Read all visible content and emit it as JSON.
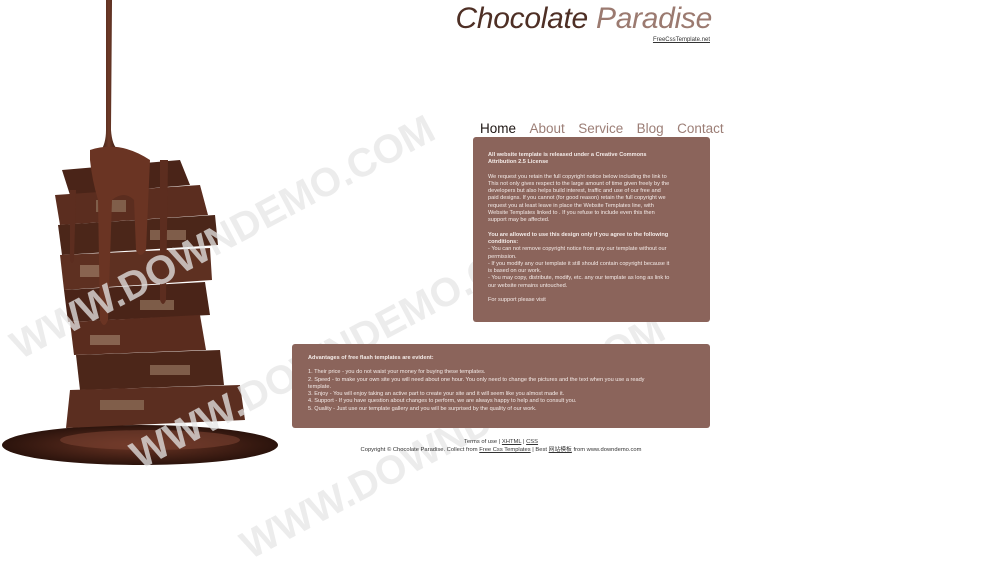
{
  "header": {
    "title_word1": "Chocolate",
    "title_word2": "Paradise",
    "credit_link": "FreeCssTemplate.net"
  },
  "nav": {
    "items": [
      "Home",
      "About",
      "Service",
      "Blog",
      "Contact"
    ],
    "active": "Home"
  },
  "license_box": {
    "heading_line1": "All website template is released under a Creative Commons",
    "heading_line2": "Attribution 2.5 License",
    "paragraph_lines": [
      "We request you retain the full copyright notice below including the link to",
      "This not only gives respect to the large amount of time given freely by the",
      "developers but also helps build interest, traffic and use of our free and",
      "paid designs. If you cannot (for good reason) retain the full copyright we",
      "request you at least leave in place the Website Templates line, with",
      "Website Templates linked to . If you refuse to include even this then",
      "support may be affected."
    ],
    "conditions_heading_line1": "You are allowed to use this design only if you agree to the following",
    "conditions_heading_line2": "conditions:",
    "conditions_lines": [
      "- You can not remove copyright notice from any our template without our",
      "permission.",
      "- If you modify any our template it still should contain copyright because it",
      "is based on our work.",
      "- You may copy, distribute, modify, etc. any our template as long as link to",
      "our website remains untouched."
    ],
    "support_text": "For support please visit"
  },
  "advantages_box": {
    "heading": "Advantages of free flash templates are evident:",
    "lines": [
      "1. Their price - you do not waist your money for buying these templates.",
      "2. Speed - to make your own site you will need about one hour. You only need to change the pictures and the text when you use a ready",
      "template.",
      "3. Enjoy - You will enjoy taking an active part to create your site and it will seem like you almost made it.",
      "4. Support - If you have question about changes to perform, we are always happy to help and to consult you.",
      "5. Quality - Just use our template gallery and you will be surprised by the quality of our work."
    ]
  },
  "footer": {
    "terms_text": "Terms of use |",
    "xhtml_link": "XHTML",
    "sep": "|",
    "css_link": "CSS",
    "copyright_text": "Copyright © Chocolate Paradise. Collect from",
    "free_css_link": "Free Css Templates",
    "best_text": "| Best",
    "chinese_link": "网站模板",
    "from_text": "from www.downdemo.com"
  },
  "watermark": {
    "text": "WWW.DOWNDEMO.COM"
  },
  "colors": {
    "box_bg": "#8b645b",
    "title_dark": "#4e2f25",
    "title_light": "#9b7a70",
    "nav_inactive": "#9c7e76",
    "nav_active": "#1e1613"
  }
}
